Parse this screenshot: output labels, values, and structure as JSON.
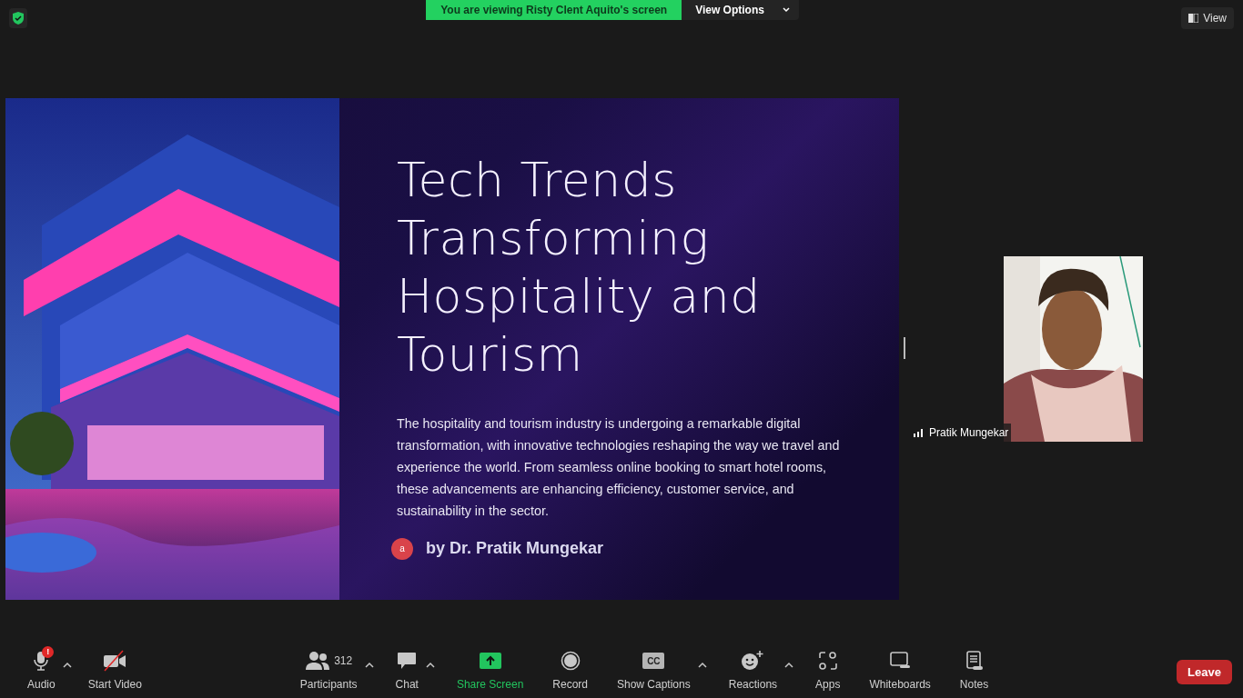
{
  "top_bar": {
    "banner": "You are viewing Risty Clent Aquito's screen",
    "view_options": "View Options",
    "view_button": "View"
  },
  "slide": {
    "title": "Tech Trends Transforming Hospitality and Tourism",
    "body": "The hospitality and tourism industry is undergoing a remarkable digital transformation, with innovative technologies reshaping the way we travel and experience the world. From seamless online booking to smart hotel rooms, these advancements are enhancing efficiency, customer service, and sustainability in the sector.",
    "avatar_letter": "a",
    "author": "by Dr. Pratik Mungekar"
  },
  "participant": {
    "name": "Pratik Mungekar"
  },
  "toolbar": [
    {
      "kind": "audio",
      "label": "Audio",
      "badge": "!",
      "caret": true,
      "highlighted": false
    },
    {
      "kind": "video",
      "label": "Start Video",
      "caret": false,
      "highlighted": false
    },
    {
      "kind": "participants",
      "label": "Participants",
      "count": "312",
      "caret": true,
      "highlighted": false
    },
    {
      "kind": "chat",
      "label": "Chat",
      "caret": true,
      "highlighted": false
    },
    {
      "kind": "share",
      "label": "Share Screen",
      "caret": false,
      "highlighted": true
    },
    {
      "kind": "record",
      "label": "Record",
      "caret": false,
      "highlighted": false
    },
    {
      "kind": "captions",
      "label": "Show Captions",
      "icon_text": "CC",
      "caret": true,
      "highlighted": false
    },
    {
      "kind": "reactions",
      "label": "Reactions",
      "caret": true,
      "highlighted": false
    },
    {
      "kind": "apps",
      "label": "Apps",
      "caret": false,
      "highlighted": false
    },
    {
      "kind": "whiteboards",
      "label": "Whiteboards",
      "caret": false,
      "highlighted": false
    },
    {
      "kind": "notes",
      "label": "Notes",
      "caret": false,
      "highlighted": false
    }
  ],
  "leave": "Leave"
}
